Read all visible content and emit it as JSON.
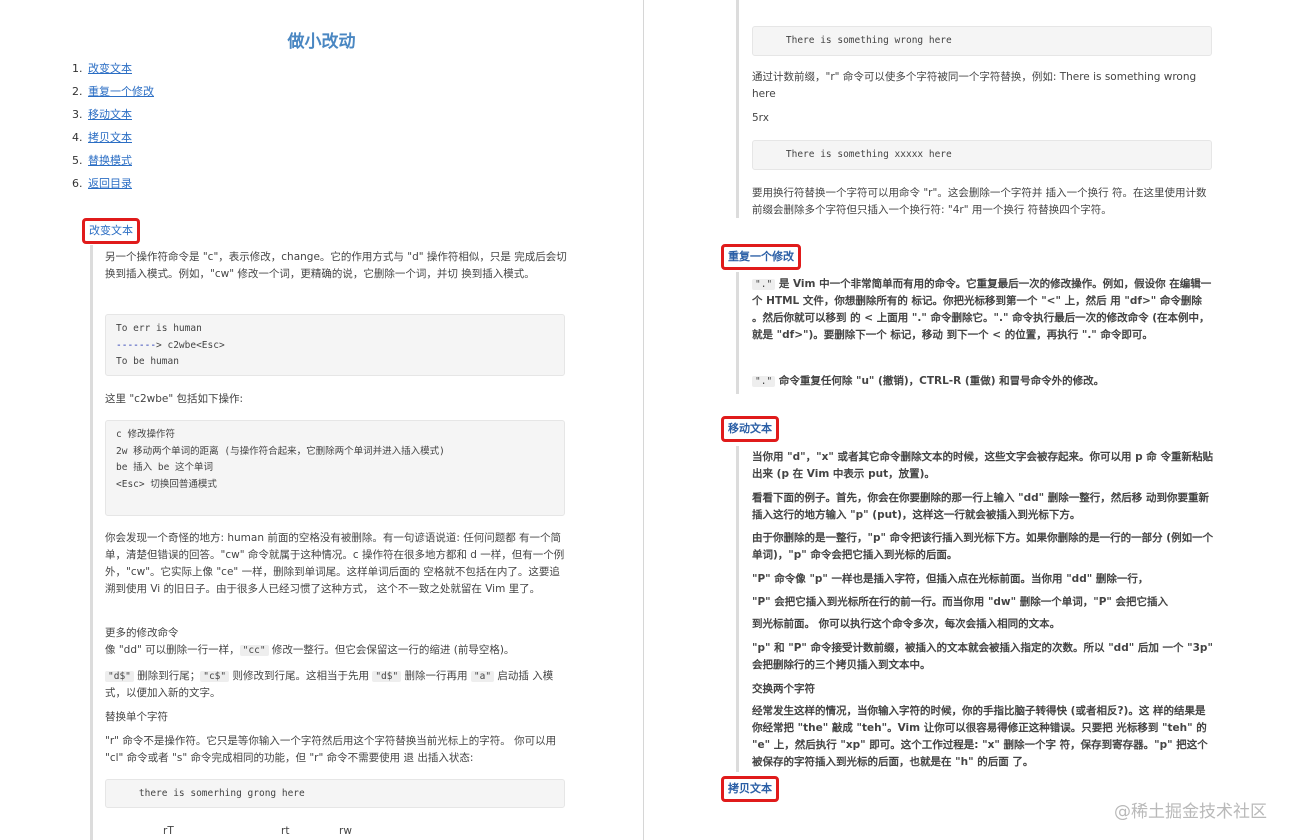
{
  "left": {
    "title": "做小改动",
    "toc": [
      {
        "num": "1.",
        "label": "改变文本"
      },
      {
        "num": "2.",
        "label": "重复一个修改"
      },
      {
        "num": "3.",
        "label": "移动文本"
      },
      {
        "num": "4.",
        "label": "拷贝文本"
      },
      {
        "num": "5.",
        "label": "替换模式"
      },
      {
        "num": "6.",
        "label": "返回目录"
      }
    ],
    "section_change": "改变文本",
    "intro": "另一个操作符命令是 \"c\"，表示修改，change。它的作用方式与 \"d\" 操作符相似，只是 完成后会切换到插入模式。例如，\"cw\" 修改一个词，更精确的说，它删除一个词，并切 换到插入模式。",
    "code1": {
      "line1": "To err is human",
      "arrow": "-------",
      "line2_rest": "> c2wbe<Esc>",
      "line3": "To be human"
    },
    "c2wbe_intro": "这里 \"c2wbe\" 包括如下操作:",
    "code2": [
      "c 修改操作符",
      "2w 移动两个单词的距离 (与操作符合起来，它删除两个单词并进入插入模式)",
      "be 插入 be 这个单词",
      "<Esc> 切换回普通模式"
    ],
    "oddity": "你会发现一个奇怪的地方: human 前面的空格没有被删除。有一句谚语说道: 任何问题都 有一个简单，清楚但错误的回答。\"cw\" 命令就属于这种情况。c 操作符在很多地方都和 d 一样，但有一个例外，\"cw\"。它实际上像 \"ce\" 一样，删除到单词尾。这样单词后面的 空格就不包括在内了。这要追溯到使用 Vi 的旧日子。由于很多人已经习惯了这种方式， 这个不一致之处就留在 Vim 里了。",
    "more_title": "更多的修改命令",
    "cc_pre": "像 \"dd\" 可以删除一行一样，",
    "cc_code": "\"cc\"",
    "cc_post": " 修改一整行。但它会保留这一行的缩进 (前导空格)。",
    "dsign_code": "\"d$\"",
    "dsign_mid1": " 删除到行尾；",
    "csign_code": "\"c$\"",
    "dsign_mid2": " 则修改到行尾。这相当于先用 ",
    "dsign_code2": "\"d$\"",
    "dsign_mid3": " 删除一行再用 ",
    "a_code": "\"a\"",
    "dsign_post": " 启动插 入模式，以便加入新的文字。",
    "replace_title": "替换单个字符",
    "replace_desc": "\"r\" 命令不是操作符。它只是等你输入一个字符然后用这个字符替换当前光标上的字符。 你可以用 \"cl\" 命令或者 \"s\" 命令完成相同的功能，但 \"r\" 命令不需要使用 退 出插入状态:",
    "code3": "    there is somerhing grong here",
    "bottom": [
      "rT",
      "rt",
      "rw"
    ]
  },
  "right": {
    "code_a": "    There is something wrong here",
    "count_desc": "通过计数前缀，\"r\" 命令可以使多个字符被同一个字符替换，例如: There is something wrong here",
    "five_rx": "5rx",
    "code_b": "    There is something xxxxx here",
    "newline_desc": "要用换行符替换一个字符可以用命令 \"r\"。这会删除一个字符并 插入一个换行 符。在这里使用计数前缀会删除多个字符但只插入一个换行符: \"4r\" 用一个换行 符替换四个字符。",
    "section_repeat": "重复一个修改",
    "dot_code": "\".\"",
    "dot_desc": " 是 Vim 中一个非常简单而有用的命令。它重复最后一次的修改操作。例如，假设你 在编辑一个 HTML 文件，你想删除所有的 标记。你把光标移到第一个 \"<\" 上，然后 用 \"df>\" 命令删除 。然后你就可以移到 的 < 上面用 \".\" 命令删除它。\".\" 命令执行最后一次的修改命令 (在本例中，就是 \"df>\")。要删除下一个 标记，移动 到下一个 < 的位置，再执行 \".\" 命令即可。",
    "dot_code2": "\".\"",
    "dot_desc2": " 命令重复任何除 \"u\" (撤销)，CTRL-R (重做) 和冒号命令外的修改。",
    "section_move": "移动文本",
    "move_paras": [
      "当你用 \"d\"，\"x\" 或者其它命令删除文本的时候，这些文字会被存起来。你可以用 p 命 令重新粘贴出来 (p 在 Vim 中表示 put，放置)。",
      "看看下面的例子。首先，你会在你要删除的那一行上输入 \"dd\" 删除一整行，然后移 动到你要重新插入这行的地方输入 \"p\" (put)，这样这一行就会被插入到光标下方。",
      "由于你删除的是一整行，\"p\" 命令把该行插入到光标下方。如果你删除的是一行的一部分 (例如一个单词)，\"p\" 命令会把它插入到光标的后面。",
      "\"P\" 命令像 \"p\" 一样也是插入字符，但插入点在光标前面。当你用 \"dd\" 删除一行，",
      "\"P\" 会把它插入到光标所在行的前一行。而当你用 \"dw\" 删除一个单词，\"P\" 会把它插入",
      "到光标前面。 你可以执行这个命令多次，每次会插入相同的文本。",
      "\"p\" 和 \"P\" 命令接受计数前缀，被插入的文本就会被插入指定的次数。所以 \"dd\" 后加 一个 \"3p\" 会把删除行的三个拷贝插入到文本中。",
      "交换两个字符",
      "经常发生这样的情况，当你输入字符的时候，你的手指比脑子转得快 (或者相反?)。这 样的结果是你经常把 \"the\" 敲成 \"teh\"。Vim 让你可以很容易得修正这种错误。只要把 光标移到 \"teh\" 的 \"e\" 上，然后执行 \"xp\" 即可。这个工作过程是: \"x\" 删除一个字 符，保存到寄存器。\"p\" 把这个被保存的字符插入到光标的后面，也就是在 \"h\" 的后面 了。"
    ],
    "section_copy": "拷贝文本",
    "watermark": "@稀土掘金技术社区"
  }
}
